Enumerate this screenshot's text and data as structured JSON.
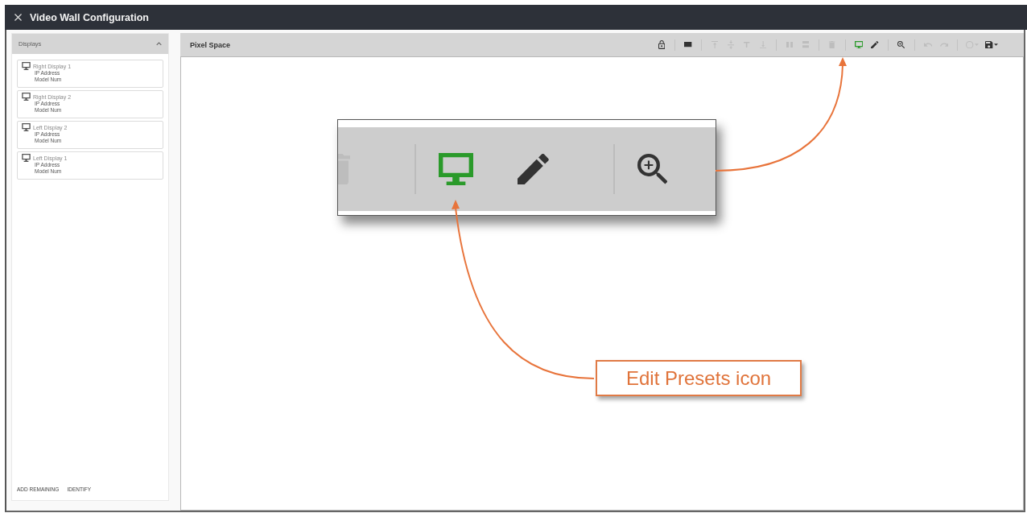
{
  "window": {
    "title": "Video Wall Configuration"
  },
  "sidebar": {
    "title": "Displays",
    "expanded": true,
    "items": [
      {
        "name": "Right Display 1",
        "fields": [
          "IP Address",
          "Model Num"
        ]
      },
      {
        "name": "Right Display 2",
        "fields": [
          "IP Address",
          "Model Num"
        ]
      },
      {
        "name": "Left Display 2",
        "fields": [
          "IP Address",
          "Model Num"
        ]
      },
      {
        "name": "Left Display 1",
        "fields": [
          "IP Address",
          "Model Num"
        ]
      }
    ],
    "buttons": [
      "ADD REMAINING",
      "IDENTIFY"
    ]
  },
  "canvas": {
    "title": "Pixel Space",
    "toolbar_groups": [
      {
        "tools": [
          {
            "kind": "lock",
            "selected": false,
            "disabled": false
          }
        ]
      },
      {
        "tools": [
          {
            "kind": "rectangle",
            "selected": false,
            "disabled": false
          }
        ]
      },
      {
        "tools": [
          {
            "kind": "align_top",
            "selected": false,
            "disabled": true
          },
          {
            "kind": "align_middle",
            "selected": false,
            "disabled": true
          },
          {
            "kind": "text",
            "selected": false,
            "disabled": true
          },
          {
            "kind": "align_bottom",
            "selected": false,
            "disabled": true
          }
        ]
      },
      {
        "tools": [
          {
            "kind": "columns",
            "selected": false,
            "disabled": true
          },
          {
            "kind": "rows",
            "selected": false,
            "disabled": true
          }
        ]
      },
      {
        "tools": [
          {
            "kind": "trash",
            "selected": false,
            "disabled": true
          }
        ]
      },
      {
        "tools": [
          {
            "kind": "monitor",
            "selected": true,
            "disabled": false
          },
          {
            "kind": "pencil",
            "selected": false,
            "disabled": false
          }
        ]
      },
      {
        "tools": [
          {
            "kind": "zoom",
            "selected": false,
            "disabled": false
          }
        ]
      },
      {
        "tools": [
          {
            "kind": "undo",
            "selected": false,
            "disabled": true
          },
          {
            "kind": "redo",
            "selected": false,
            "disabled": true
          }
        ]
      },
      {
        "tools": [
          {
            "kind": "circle_menu",
            "selected": false,
            "disabled": true
          },
          {
            "kind": "save_menu",
            "selected": false,
            "disabled": false
          }
        ]
      }
    ]
  },
  "zoom_inset": {
    "groups": [
      {
        "tools": [
          {
            "kind": "trash",
            "selected": false,
            "disabled": true
          }
        ]
      },
      {
        "tools": [
          {
            "kind": "monitor",
            "selected": true,
            "disabled": false
          },
          {
            "kind": "pencil",
            "selected": false,
            "disabled": false
          }
        ]
      },
      {
        "tools": [
          {
            "kind": "zoom",
            "selected": false,
            "disabled": false
          }
        ]
      }
    ]
  },
  "callout": {
    "label": "Edit Presets icon"
  }
}
